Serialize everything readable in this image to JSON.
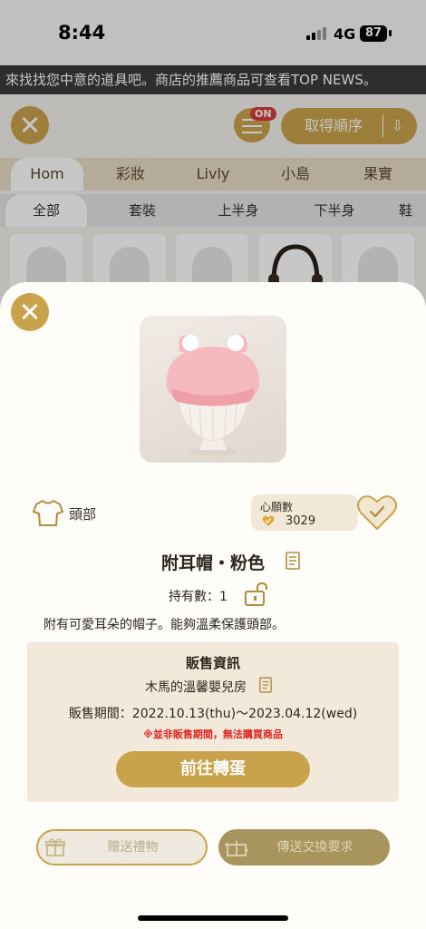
{
  "status_bar": {
    "time": "8:44",
    "network": "4G",
    "battery": "87"
  },
  "ticker": {
    "text": "來找找您中意的道具吧。商店的推薦商品可查看TOP NEWS。"
  },
  "toolbar": {
    "filter_badge": "ON",
    "sort_label": "取得順序"
  },
  "category_tabs": [
    "Hom",
    "彩妝",
    "Livly",
    "小島",
    "果實"
  ],
  "sub_tabs": [
    "全部",
    "套裝",
    "上半身",
    "下半身",
    "鞋"
  ],
  "modal": {
    "slot_label": "頭部",
    "wish": {
      "label": "心願數",
      "count": "3029"
    },
    "item_name": "附耳帽・粉色",
    "owned": "持有數：1",
    "description": "附有可愛耳朵的帽子。能夠溫柔保護頭部。",
    "sale_info": {
      "title": "販售資訊",
      "shop": "木馬的溫馨嬰兒房",
      "period": "販售期間：2022.10.13(thu)〜2023.04.12(wed)",
      "warning": "※並非販售期間，無法購買商品"
    },
    "goto_button": "前往轉蛋",
    "gift_button": "贈送禮物",
    "trade_button": "傳送交換要求"
  },
  "colors": {
    "accent": "#c9a24c",
    "panel": "#f3e9da",
    "warning": "#e02020"
  }
}
